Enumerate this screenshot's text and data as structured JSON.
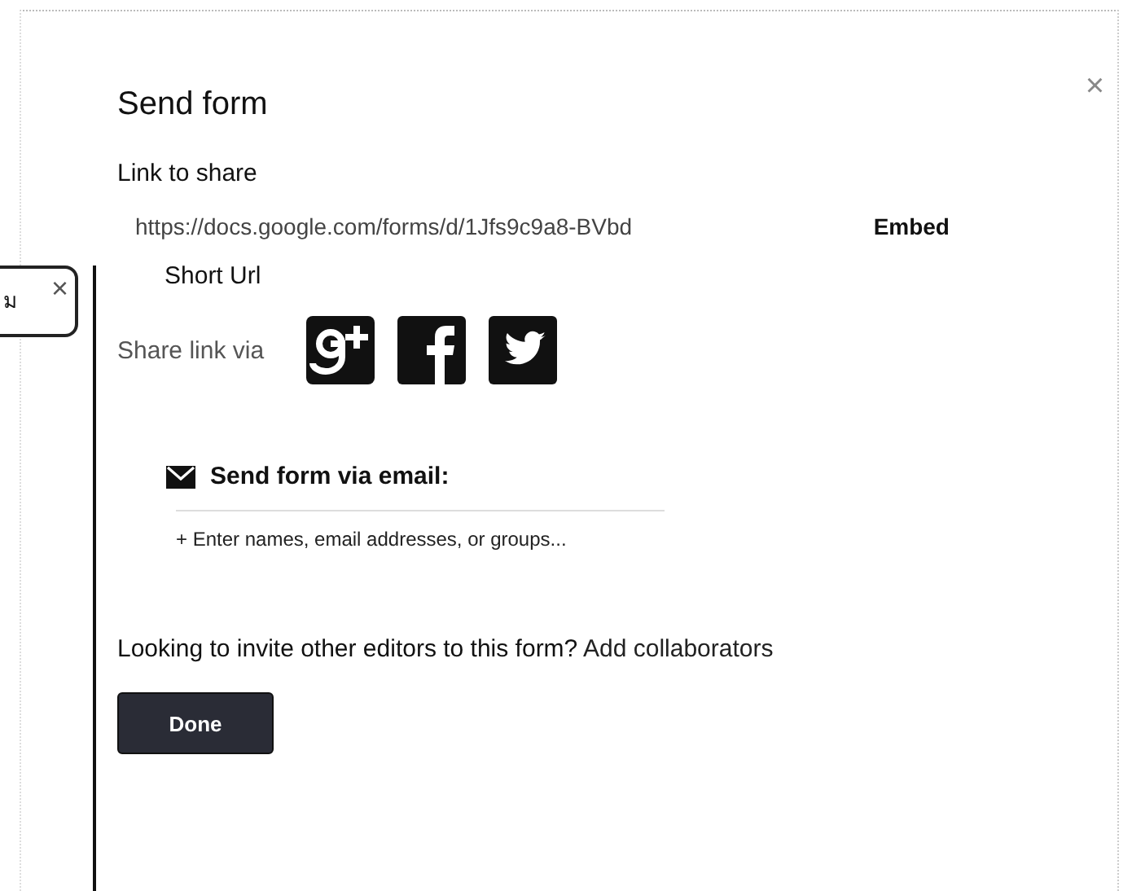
{
  "dialog": {
    "title": "Send form",
    "close": "×",
    "link_section": {
      "label": "Link to share",
      "url": "https://docs.google.com/forms/d/1Jfs9c9a8-BVbd",
      "embed": "Embed",
      "short_url": "Short Url"
    },
    "share": {
      "label": "Share link via",
      "networks": [
        {
          "kind": "googleplus"
        },
        {
          "kind": "facebook"
        },
        {
          "kind": "twitter"
        }
      ]
    },
    "email": {
      "label": "Send form via email:",
      "placeholder": "+ Enter names, email addresses, or groups..."
    },
    "collaborators": {
      "text": "Looking to invite other editors to this form?",
      "link": "Add collaborators"
    },
    "buttons": [
      "Done"
    ]
  },
  "background_popup": {
    "text": "ม",
    "close": "×"
  }
}
